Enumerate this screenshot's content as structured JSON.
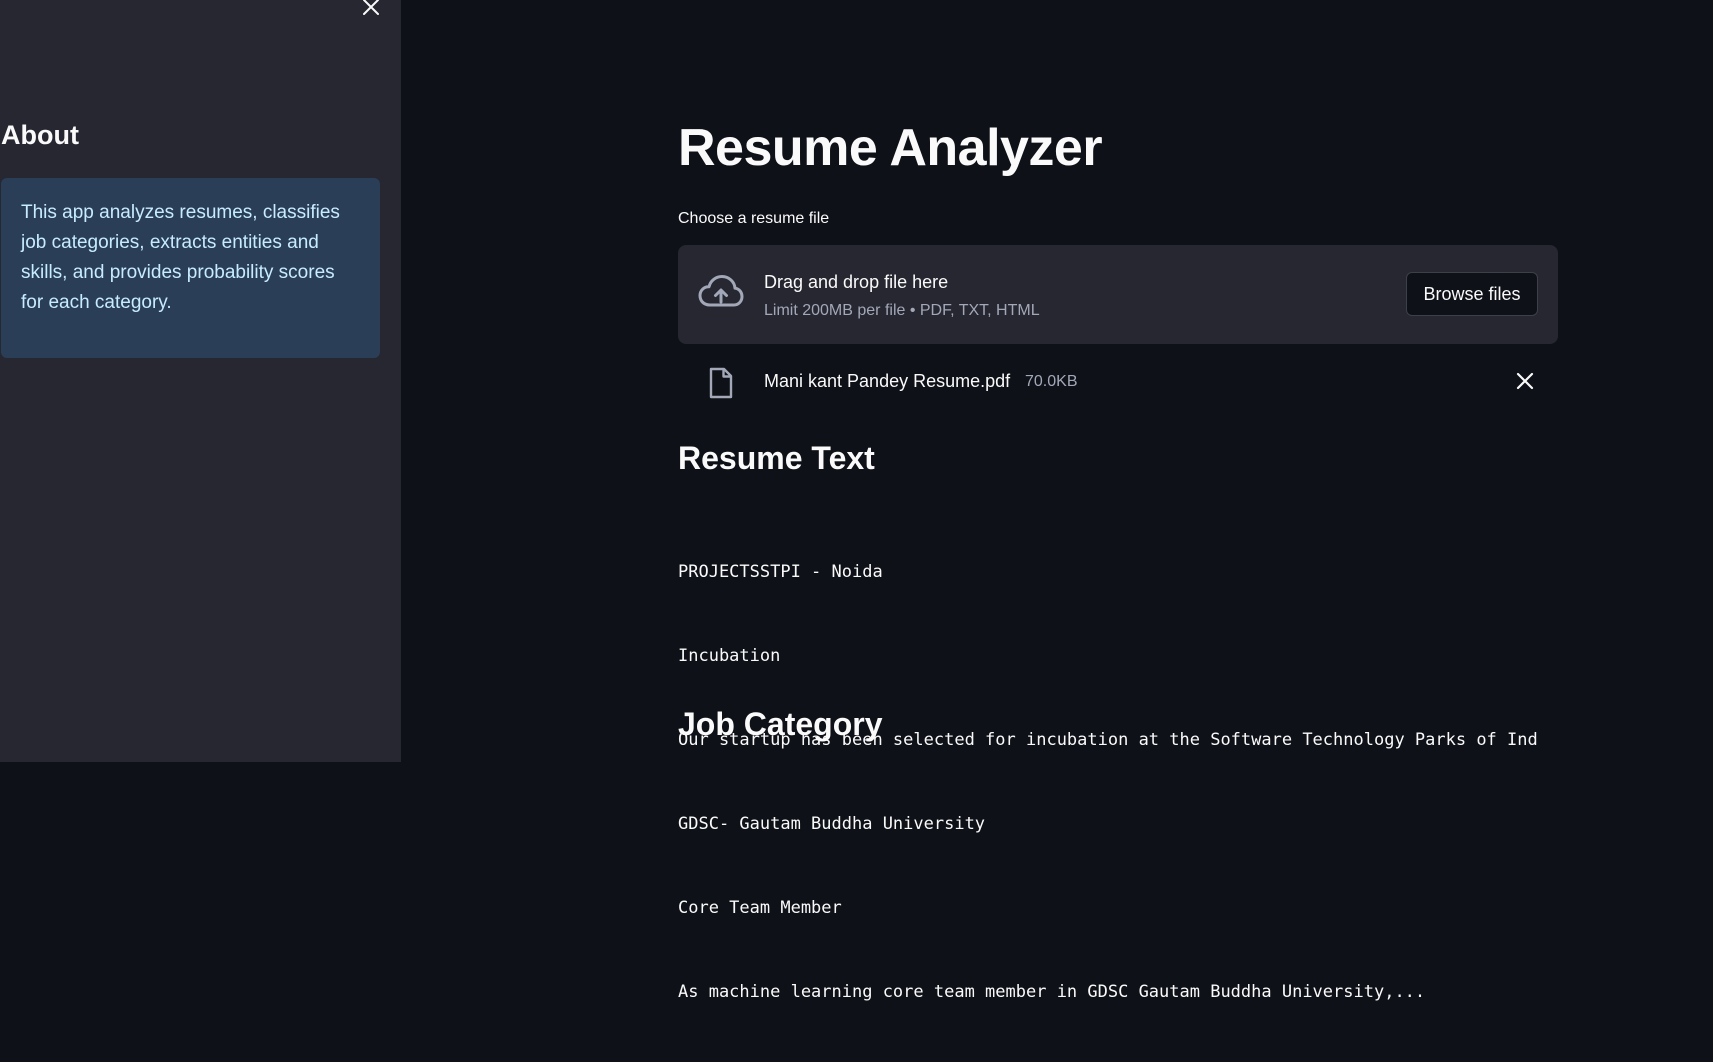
{
  "sidebar": {
    "close_icon": "close-icon",
    "about_title": "About",
    "about_text": "This app analyzes resumes, classifies job categories, extracts entities and skills, and provides probability scores for each category."
  },
  "main": {
    "title": "Resume Analyzer",
    "uploader": {
      "label": "Choose a resume file",
      "icon": "cloud-upload-icon",
      "drop_text": "Drag and drop file here",
      "limit_text": "Limit 200MB per file • PDF, TXT, HTML",
      "browse_label": "Browse files"
    },
    "uploaded_file": {
      "icon": "file-icon",
      "name": "Mani kant Pandey Resume.pdf",
      "size": "70.0KB",
      "remove_icon": "close-icon"
    },
    "resume_section": {
      "heading": "Resume Text",
      "lines": [
        "PROJECTSSTPI - Noida",
        "Incubation",
        "Our startup has been selected for incubation at the Software Technology Parks of Ind",
        "GDSC- Gautam Buddha University",
        "Core Team Member",
        "As machine learning core team member in GDSC Gautam Buddha University,..."
      ]
    },
    "job_section": {
      "heading": "Job Category"
    }
  },
  "colors": {
    "background": "#0e1117",
    "sidebar": "#262730",
    "info_box": "#1f3a5a",
    "info_text": "#c7ebff",
    "muted_text": "#a3a8b8"
  }
}
